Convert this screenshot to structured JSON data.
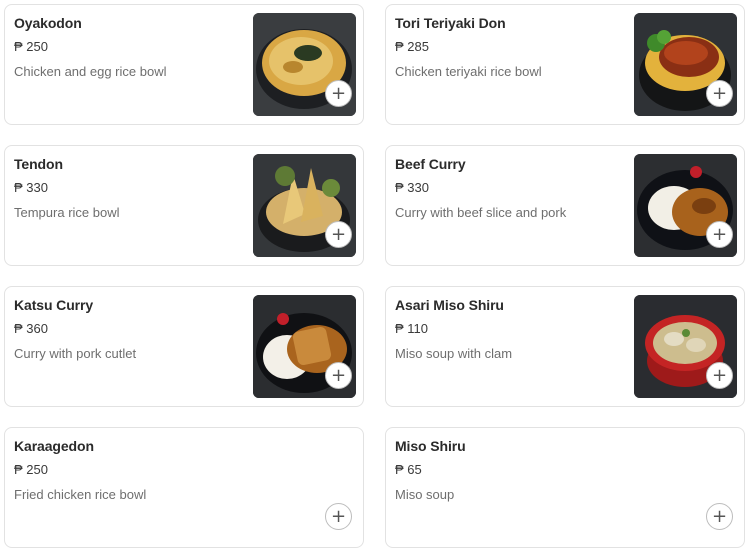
{
  "add_icon_glyph": "+",
  "items": [
    {
      "name": "Oyakodon",
      "price": "₱ 250",
      "description": "Chicken and egg rice bowl",
      "has_image": true,
      "image_icon": "oyakodon-photo"
    },
    {
      "name": "Tori Teriyaki Don",
      "price": "₱ 285",
      "description": "Chicken teriyaki rice bowl",
      "has_image": true,
      "image_icon": "teriyaki-don-photo"
    },
    {
      "name": "Tendon",
      "price": "₱ 330",
      "description": "Tempura rice bowl",
      "has_image": true,
      "image_icon": "tendon-photo"
    },
    {
      "name": "Beef Curry",
      "price": "₱ 330",
      "description": "Curry with beef slice and pork",
      "has_image": true,
      "image_icon": "beef-curry-photo"
    },
    {
      "name": "Katsu Curry",
      "price": "₱ 360",
      "description": "Curry with pork cutlet",
      "has_image": true,
      "image_icon": "katsu-curry-photo"
    },
    {
      "name": "Asari Miso Shiru",
      "price": "₱ 110",
      "description": "Miso soup with clam",
      "has_image": true,
      "image_icon": "miso-clam-photo"
    },
    {
      "name": "Karaagedon",
      "price": "₱ 250",
      "description": "Fried chicken rice bowl",
      "has_image": false
    },
    {
      "name": "Miso Shiru",
      "price": "₱ 65",
      "description": "Miso soup",
      "has_image": false
    }
  ]
}
